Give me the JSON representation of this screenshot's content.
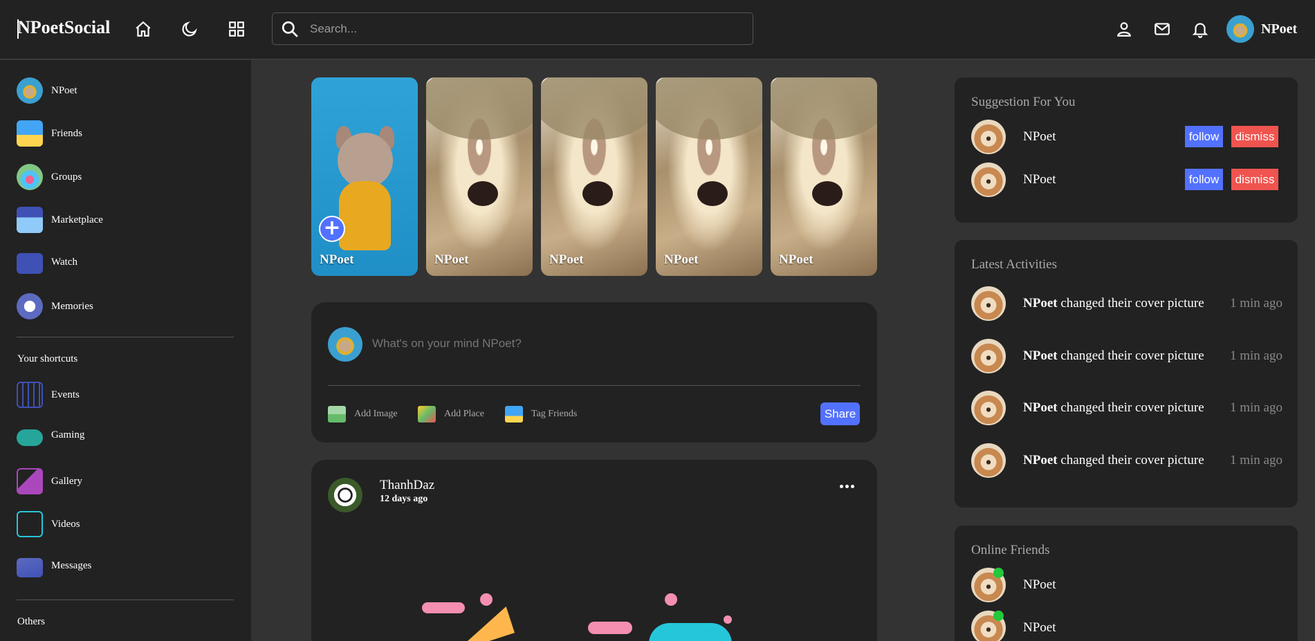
{
  "navbar": {
    "logo": "NPoetSocial",
    "search_placeholder": "Search...",
    "user_name": "NPoet"
  },
  "sidebar": {
    "items": [
      {
        "label": "NPoet",
        "icon": "user-avatar-icon"
      },
      {
        "label": "Friends",
        "icon": "friends-icon"
      },
      {
        "label": "Groups",
        "icon": "groups-icon"
      },
      {
        "label": "Marketplace",
        "icon": "marketplace-icon"
      },
      {
        "label": "Watch",
        "icon": "watch-icon"
      },
      {
        "label": "Memories",
        "icon": "memories-icon"
      }
    ],
    "shortcuts_heading": "Your shortcuts",
    "shortcuts": [
      {
        "label": "Events",
        "icon": "events-icon"
      },
      {
        "label": "Gaming",
        "icon": "gaming-icon"
      },
      {
        "label": "Gallery",
        "icon": "gallery-icon"
      },
      {
        "label": "Videos",
        "icon": "videos-icon"
      },
      {
        "label": "Messages",
        "icon": "messages-icon"
      }
    ],
    "others_heading": "Others"
  },
  "stories": [
    {
      "name": "NPoet"
    },
    {
      "name": "NPoet"
    },
    {
      "name": "NPoet"
    },
    {
      "name": "NPoet"
    },
    {
      "name": "NPoet"
    }
  ],
  "create_post": {
    "placeholder": "What's on your mind NPoet?",
    "add_image": "Add Image",
    "add_place": "Add Place",
    "tag_friends": "Tag Friends",
    "share": "Share"
  },
  "post": {
    "author": "ThanhDaz",
    "time": "12 days ago"
  },
  "suggestions": {
    "title": "Suggestion For You",
    "users": [
      {
        "name": "NPoet",
        "follow": "follow",
        "dismiss": "dismiss"
      },
      {
        "name": "NPoet",
        "follow": "follow",
        "dismiss": "dismiss"
      }
    ]
  },
  "activities": {
    "title": "Latest Activities",
    "items": [
      {
        "user": "NPoet",
        "text": "changed their cover picture",
        "time": "1 min ago"
      },
      {
        "user": "NPoet",
        "text": "changed their cover picture",
        "time": "1 min ago"
      },
      {
        "user": "NPoet",
        "text": "changed their cover picture",
        "time": "1 min ago"
      },
      {
        "user": "NPoet",
        "text": "changed their cover picture",
        "time": "1 min ago"
      }
    ]
  },
  "online": {
    "title": "Online Friends",
    "users": [
      {
        "name": "NPoet"
      },
      {
        "name": "NPoet"
      }
    ]
  },
  "colors": {
    "accent": "#5271ff",
    "dismiss": "#f0544f",
    "online": "#22c93a",
    "panel": "#222222",
    "background": "#333333"
  }
}
